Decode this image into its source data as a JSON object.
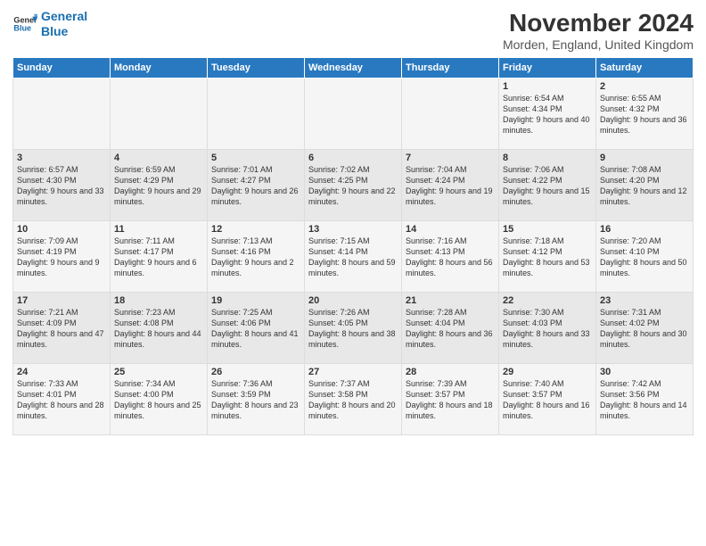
{
  "logo": {
    "line1": "General",
    "line2": "Blue"
  },
  "title": "November 2024",
  "subtitle": "Morden, England, United Kingdom",
  "headers": [
    "Sunday",
    "Monday",
    "Tuesday",
    "Wednesday",
    "Thursday",
    "Friday",
    "Saturday"
  ],
  "rows": [
    [
      {
        "num": "",
        "info": ""
      },
      {
        "num": "",
        "info": ""
      },
      {
        "num": "",
        "info": ""
      },
      {
        "num": "",
        "info": ""
      },
      {
        "num": "",
        "info": ""
      },
      {
        "num": "1",
        "info": "Sunrise: 6:54 AM\nSunset: 4:34 PM\nDaylight: 9 hours and 40 minutes."
      },
      {
        "num": "2",
        "info": "Sunrise: 6:55 AM\nSunset: 4:32 PM\nDaylight: 9 hours and 36 minutes."
      }
    ],
    [
      {
        "num": "3",
        "info": "Sunrise: 6:57 AM\nSunset: 4:30 PM\nDaylight: 9 hours and 33 minutes."
      },
      {
        "num": "4",
        "info": "Sunrise: 6:59 AM\nSunset: 4:29 PM\nDaylight: 9 hours and 29 minutes."
      },
      {
        "num": "5",
        "info": "Sunrise: 7:01 AM\nSunset: 4:27 PM\nDaylight: 9 hours and 26 minutes."
      },
      {
        "num": "6",
        "info": "Sunrise: 7:02 AM\nSunset: 4:25 PM\nDaylight: 9 hours and 22 minutes."
      },
      {
        "num": "7",
        "info": "Sunrise: 7:04 AM\nSunset: 4:24 PM\nDaylight: 9 hours and 19 minutes."
      },
      {
        "num": "8",
        "info": "Sunrise: 7:06 AM\nSunset: 4:22 PM\nDaylight: 9 hours and 15 minutes."
      },
      {
        "num": "9",
        "info": "Sunrise: 7:08 AM\nSunset: 4:20 PM\nDaylight: 9 hours and 12 minutes."
      }
    ],
    [
      {
        "num": "10",
        "info": "Sunrise: 7:09 AM\nSunset: 4:19 PM\nDaylight: 9 hours and 9 minutes."
      },
      {
        "num": "11",
        "info": "Sunrise: 7:11 AM\nSunset: 4:17 PM\nDaylight: 9 hours and 6 minutes."
      },
      {
        "num": "12",
        "info": "Sunrise: 7:13 AM\nSunset: 4:16 PM\nDaylight: 9 hours and 2 minutes."
      },
      {
        "num": "13",
        "info": "Sunrise: 7:15 AM\nSunset: 4:14 PM\nDaylight: 8 hours and 59 minutes."
      },
      {
        "num": "14",
        "info": "Sunrise: 7:16 AM\nSunset: 4:13 PM\nDaylight: 8 hours and 56 minutes."
      },
      {
        "num": "15",
        "info": "Sunrise: 7:18 AM\nSunset: 4:12 PM\nDaylight: 8 hours and 53 minutes."
      },
      {
        "num": "16",
        "info": "Sunrise: 7:20 AM\nSunset: 4:10 PM\nDaylight: 8 hours and 50 minutes."
      }
    ],
    [
      {
        "num": "17",
        "info": "Sunrise: 7:21 AM\nSunset: 4:09 PM\nDaylight: 8 hours and 47 minutes."
      },
      {
        "num": "18",
        "info": "Sunrise: 7:23 AM\nSunset: 4:08 PM\nDaylight: 8 hours and 44 minutes."
      },
      {
        "num": "19",
        "info": "Sunrise: 7:25 AM\nSunset: 4:06 PM\nDaylight: 8 hours and 41 minutes."
      },
      {
        "num": "20",
        "info": "Sunrise: 7:26 AM\nSunset: 4:05 PM\nDaylight: 8 hours and 38 minutes."
      },
      {
        "num": "21",
        "info": "Sunrise: 7:28 AM\nSunset: 4:04 PM\nDaylight: 8 hours and 36 minutes."
      },
      {
        "num": "22",
        "info": "Sunrise: 7:30 AM\nSunset: 4:03 PM\nDaylight: 8 hours and 33 minutes."
      },
      {
        "num": "23",
        "info": "Sunrise: 7:31 AM\nSunset: 4:02 PM\nDaylight: 8 hours and 30 minutes."
      }
    ],
    [
      {
        "num": "24",
        "info": "Sunrise: 7:33 AM\nSunset: 4:01 PM\nDaylight: 8 hours and 28 minutes."
      },
      {
        "num": "25",
        "info": "Sunrise: 7:34 AM\nSunset: 4:00 PM\nDaylight: 8 hours and 25 minutes."
      },
      {
        "num": "26",
        "info": "Sunrise: 7:36 AM\nSunset: 3:59 PM\nDaylight: 8 hours and 23 minutes."
      },
      {
        "num": "27",
        "info": "Sunrise: 7:37 AM\nSunset: 3:58 PM\nDaylight: 8 hours and 20 minutes."
      },
      {
        "num": "28",
        "info": "Sunrise: 7:39 AM\nSunset: 3:57 PM\nDaylight: 8 hours and 18 minutes."
      },
      {
        "num": "29",
        "info": "Sunrise: 7:40 AM\nSunset: 3:57 PM\nDaylight: 8 hours and 16 minutes."
      },
      {
        "num": "30",
        "info": "Sunrise: 7:42 AM\nSunset: 3:56 PM\nDaylight: 8 hours and 14 minutes."
      }
    ]
  ]
}
